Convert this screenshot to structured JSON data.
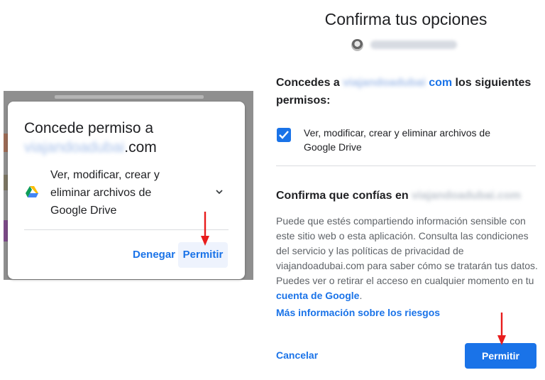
{
  "left_dialog": {
    "title_prefix": "Concede permiso a",
    "site_blurred": "viajandoadubai",
    "site_suffix": ".com",
    "permission_text": "Ver, modificar, crear y eliminar archivos de Google Drive",
    "deny_label": "Denegar",
    "allow_label": "Permitir",
    "icons": {
      "drive": "google-drive-icon",
      "chevron": "chevron-down-icon",
      "arrow": "red-arrow-down-icon"
    }
  },
  "right_panel": {
    "title": "Confirma tus opciones",
    "grant": {
      "prefix": "Concedes a",
      "site_blurred": "viajandoadubai",
      "site_suffix": "com",
      "suffix": "los siguientes permisos:"
    },
    "checkbox": {
      "checked": true,
      "label": "Ver, modificar, crear y eliminar archivos de Google Drive"
    },
    "trust_heading": "Confirma que confías en",
    "trust_site_blurred": "viajandoadubai.com",
    "info_text": "Puede que estés compartiendo información sensible con este sitio web o esta aplicación. Consulta las condiciones del servicio y las políticas de privacidad de viajandoadubai.com para saber cómo se tratarán tus datos. Puedes ver o retirar el acceso en cualquier momento en tu",
    "account_link": "cuenta de Google",
    "info_end": ".",
    "risk_link": "Más información sobre los riesgos",
    "cancel_label": "Cancelar",
    "allow_label": "Permitir"
  },
  "colors": {
    "accent": "#1a73e8",
    "arrow": "#e81c1c",
    "dim_backdrop": "#8f8f8f"
  }
}
